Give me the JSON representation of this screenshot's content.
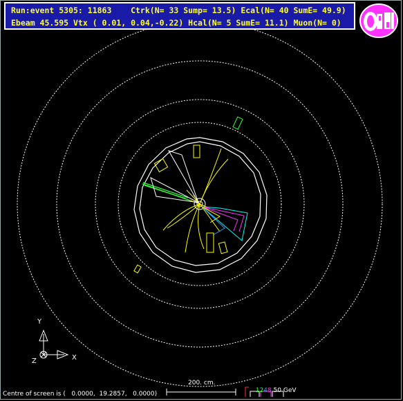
{
  "header": {
    "line1": "Run:event 5305: 11863    Ctrk(N= 33 Sump= 13.5) Ecal(N= 40 SumE= 49.9)",
    "line2": "Ebeam 45.595 Vtx ( 0.01, 0.04,-0.22) Hcal(N= 5 SumE= 11.1) Muon(N= 0)"
  },
  "logo": {
    "text": "OPAL",
    "color": "#ff33ff"
  },
  "axes": {
    "y": "Y",
    "x": "X",
    "z": "Z"
  },
  "footer": {
    "centre_note": "Centre of screen is (   0.0000,  19.2857,   0.0000)",
    "scale_label": "200. cm.",
    "energy_legend": {
      "v1": "12",
      "v2": "4",
      "v3": "8",
      "unit": "50 GeV"
    }
  },
  "colors": {
    "background": "#000000",
    "header_bg": "#1a1aa8",
    "header_text": "#ffff33",
    "tracks": "#ffff00",
    "ecal": "#ffff00",
    "hcal": "#00ffff",
    "magenta": "#ff00ff",
    "green": "#33ff33"
  }
}
